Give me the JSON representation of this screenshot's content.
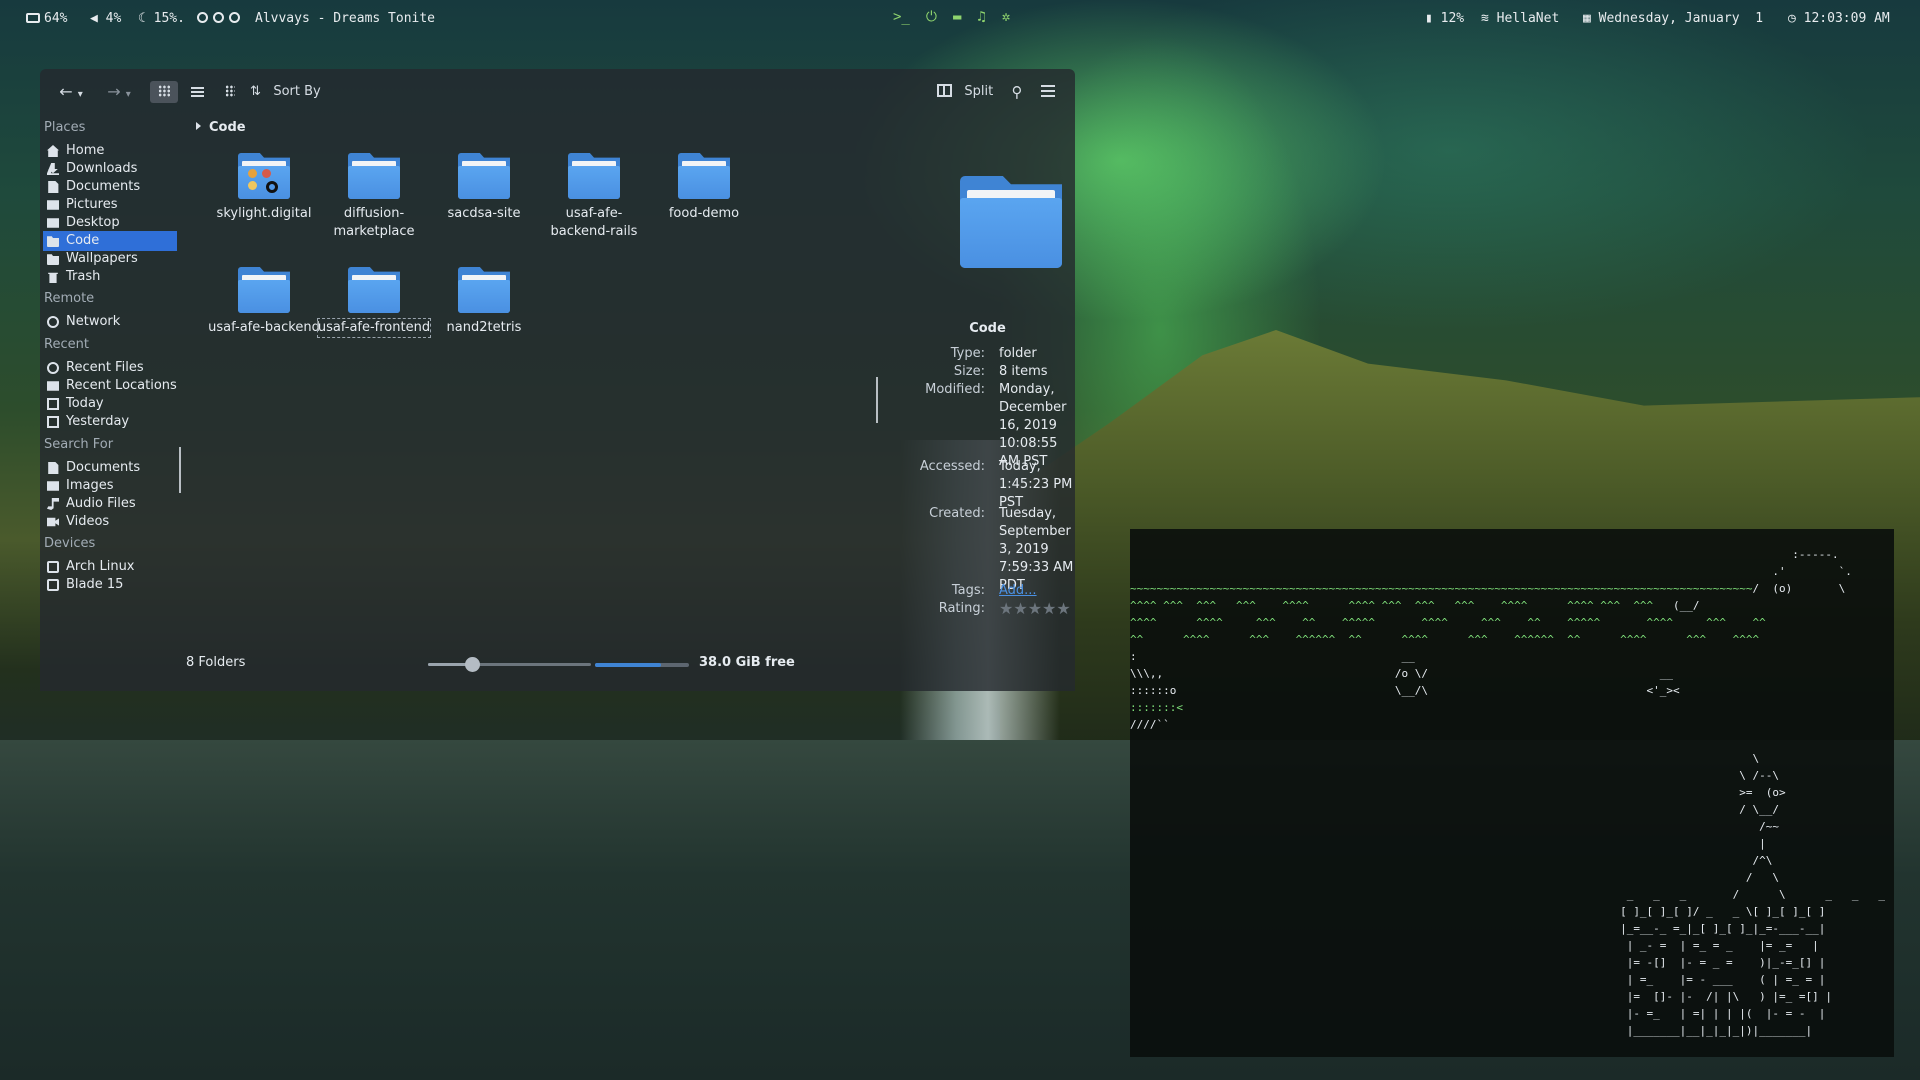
{
  "topbar": {
    "battery": "64%",
    "volume": "4%",
    "brightness": "15%.",
    "now_playing": "Alvvays - Dreams Tonite",
    "right_battery": "12%",
    "wifi": "HellaNet",
    "date": "Wednesday, January  1",
    "time": "12:03:09 AM",
    "tray_icons": [
      "terminal-icon",
      "power-icon",
      "folder-icon",
      "music-icon",
      "gamepad-icon"
    ]
  },
  "toolbar": {
    "sort_label": "Sort By",
    "split_label": "Split",
    "active_view": "icons"
  },
  "sidebar": {
    "places_heading": "Places",
    "places": [
      {
        "label": "Home",
        "icon": "home-icon"
      },
      {
        "label": "Downloads",
        "icon": "download-icon"
      },
      {
        "label": "Documents",
        "icon": "document-icon"
      },
      {
        "label": "Pictures",
        "icon": "image-icon"
      },
      {
        "label": "Desktop",
        "icon": "desktop-icon"
      },
      {
        "label": "Code",
        "icon": "folder-icon",
        "selected": true
      },
      {
        "label": "Wallpapers",
        "icon": "folder-icon"
      },
      {
        "label": "Trash",
        "icon": "trash-icon"
      }
    ],
    "remote_heading": "Remote",
    "remote": [
      {
        "label": "Network",
        "icon": "network-icon"
      }
    ],
    "recent_heading": "Recent",
    "recent": [
      {
        "label": "Recent Files",
        "icon": "clock-icon"
      },
      {
        "label": "Recent Locations",
        "icon": "location-icon"
      },
      {
        "label": "Today",
        "icon": "calendar-icon"
      },
      {
        "label": "Yesterday",
        "icon": "calendar-icon"
      }
    ],
    "search_heading": "Search For",
    "search": [
      {
        "label": "Documents",
        "icon": "document-icon"
      },
      {
        "label": "Images",
        "icon": "image-icon"
      },
      {
        "label": "Audio Files",
        "icon": "music-icon"
      },
      {
        "label": "Videos",
        "icon": "video-icon"
      }
    ],
    "devices_heading": "Devices",
    "devices": [
      {
        "label": "Arch Linux",
        "icon": "disk-icon"
      },
      {
        "label": "Blade 15",
        "icon": "disk-icon"
      }
    ]
  },
  "content": {
    "breadcrumb": "Code",
    "items": [
      {
        "name": "skylight.digital"
      },
      {
        "name": "diffusion-\nmarketplace"
      },
      {
        "name": "sacdsa-site"
      },
      {
        "name": "usaf-afe-\nbackend-rails"
      },
      {
        "name": "food-demo"
      },
      {
        "name": "usaf-afe-backend"
      },
      {
        "name": "usaf-afe-frontend",
        "focused": true
      },
      {
        "name": "nand2tetris"
      }
    ],
    "status": "8 Folders",
    "zoom_level": 0.27,
    "disk_used_fraction": 0.7,
    "free_space": "38.0 GiB free"
  },
  "info": {
    "title": "Code",
    "type_label": "Type:",
    "type_value": "folder",
    "size_label": "Size:",
    "size_value": "8 items",
    "modified_label": "Modified:",
    "modified_value": "Monday, December 16, 2019 10:08:55 AM PST",
    "accessed_label": "Accessed:",
    "accessed_value": "Today, 1:45:23 PM PST",
    "created_label": "Created:",
    "created_value": "Tuesday, September 3, 2019 7:59:33 AM PDT",
    "tags_label": "Tags:",
    "tags_value": "Add...",
    "rating_label": "Rating:",
    "rating_stars": "★★★★★",
    "rating_value": 0
  },
  "colors": {
    "accent": "#2f6fd8",
    "folder_blue": "#4a90e2",
    "terminal_green": "#7fe07a"
  }
}
